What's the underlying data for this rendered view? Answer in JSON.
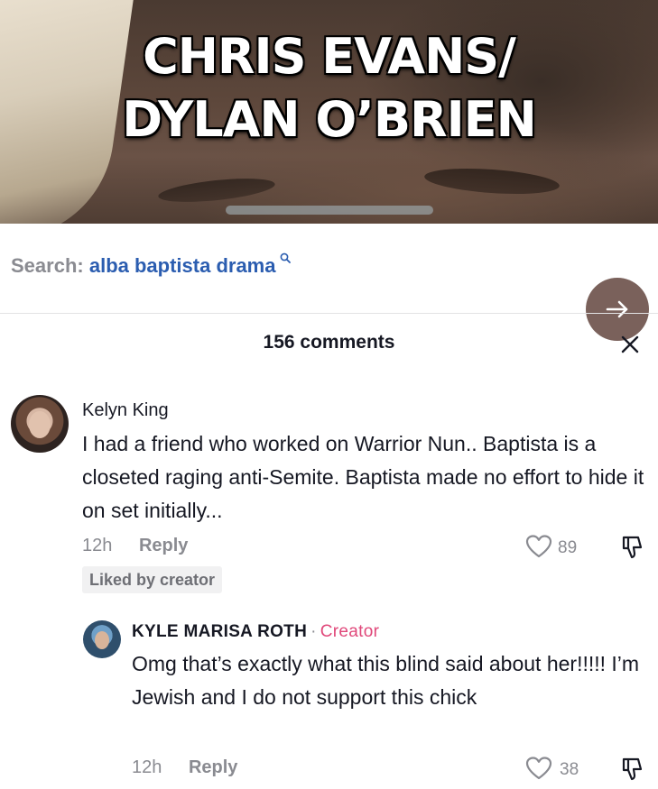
{
  "video": {
    "caption_line1": "CHRIS EVANS/",
    "caption_line2": "DYLAN O’BRIEN"
  },
  "search": {
    "label": "Search:",
    "query": "alba baptista drama",
    "icon": "search-icon"
  },
  "comments_header": {
    "count_label": "156 comments",
    "close_icon": "close-icon"
  },
  "go_button": {
    "icon": "arrow-right-icon",
    "color": "#7a615b"
  },
  "comments": [
    {
      "author": "Kelyn King",
      "text": "I had a friend who worked on Warrior Nun.. Baptista is a closeted raging anti-Semite. Baptista made no effort to hide it on set initially...",
      "time": "12h",
      "reply_label": "Reply",
      "likes": "89",
      "liked_by_creator_label": "Liked by creator"
    },
    {
      "author": "KYLE MARISA ROTH",
      "dot": "·",
      "badge": "Creator",
      "text": "Omg that’s exactly what this blind said about her!!!!! I’m Jewish and I do not support this chick",
      "time": "12h",
      "reply_label": "Reply",
      "likes": "38"
    }
  ],
  "colors": {
    "link_blue": "#2b5db0",
    "creator_pink": "#e0487a",
    "muted_gray": "#8a8b91"
  }
}
